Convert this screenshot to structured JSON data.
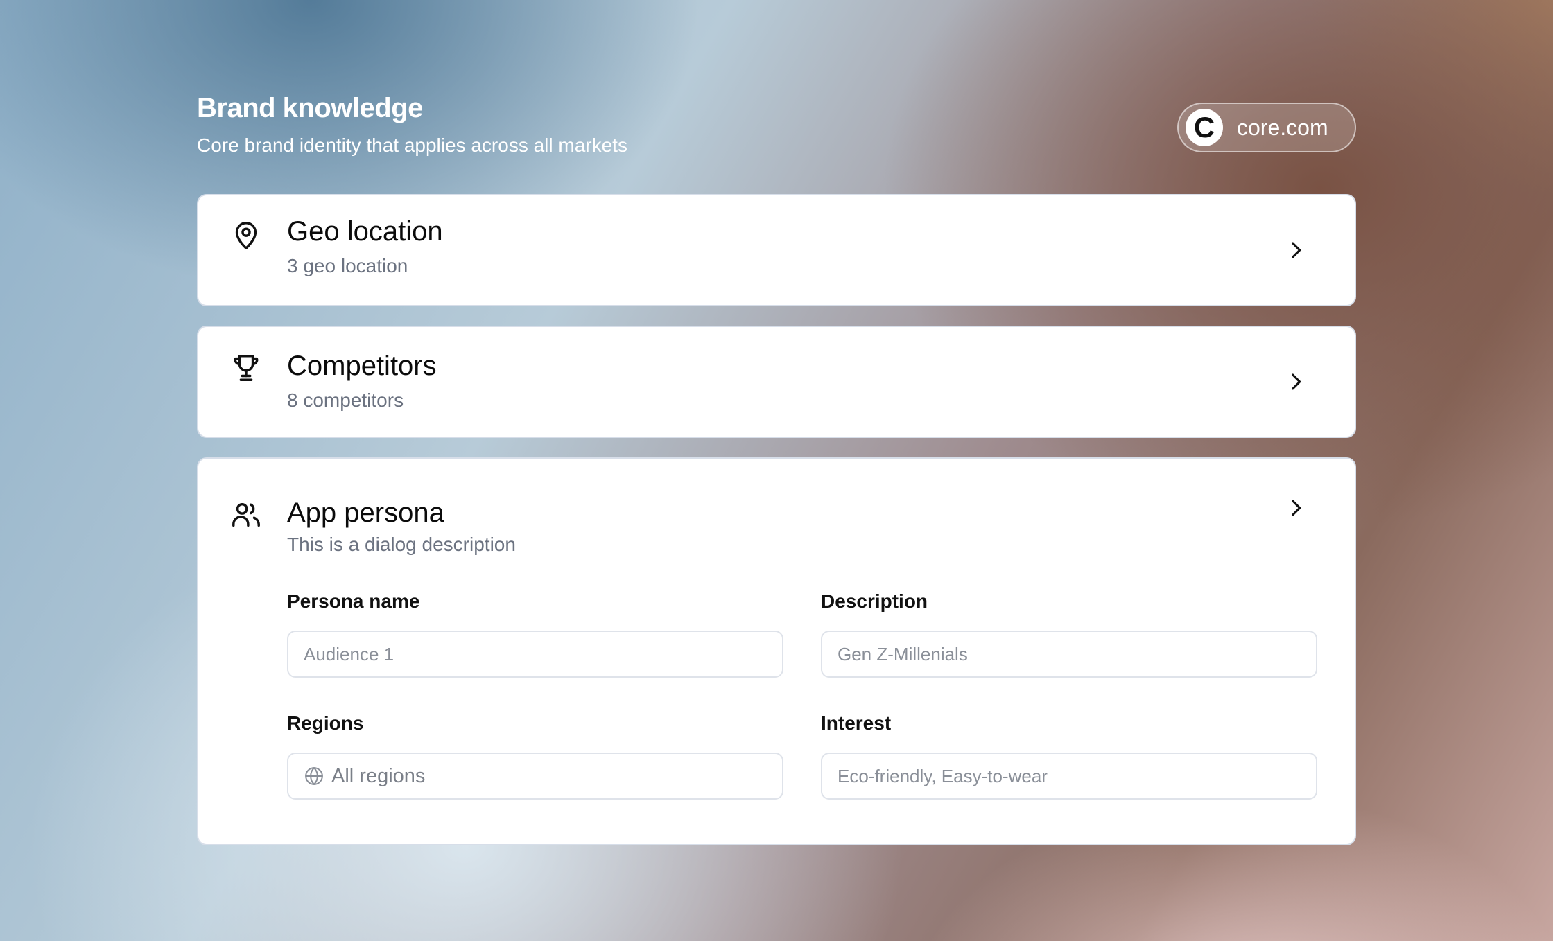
{
  "header": {
    "title": "Brand knowledge",
    "subtitle": "Core brand identity that applies across all markets"
  },
  "brand": {
    "logo_letter": "C",
    "name": "core.com"
  },
  "cards": {
    "geo": {
      "icon": "map-pin-icon",
      "title": "Geo location",
      "description": "3 geo location"
    },
    "competitors": {
      "icon": "trophy-icon",
      "title": "Competitors",
      "description": "8 competitors"
    },
    "persona": {
      "icon": "users-icon",
      "title": "App persona",
      "description": "This is a dialog description",
      "fields": {
        "persona_name": {
          "label": "Persona name",
          "placeholder": "Audience 1"
        },
        "description": {
          "label": "Description",
          "placeholder": "Gen Z-Millenials"
        },
        "regions": {
          "label": "Regions",
          "icon": "globe-icon",
          "value": "All regions"
        },
        "interest": {
          "label": "Interest",
          "placeholder": "Eco-friendly, Easy-to-wear"
        }
      }
    }
  }
}
